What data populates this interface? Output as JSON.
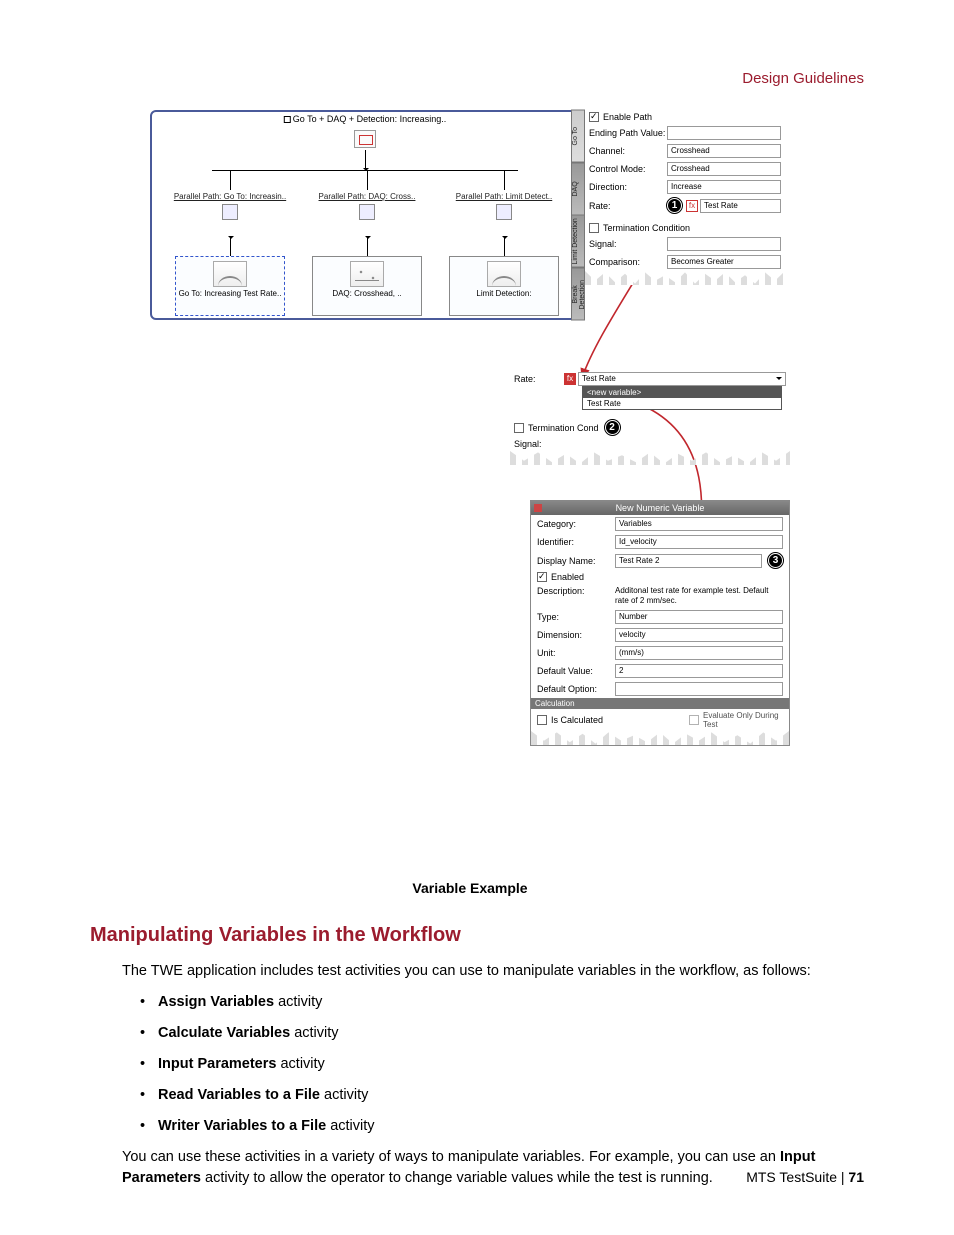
{
  "header": {
    "right": "Design Guidelines"
  },
  "workflow": {
    "title": "Go To + DAQ + Detection: Increasing..",
    "paths": [
      {
        "label": "Parallel Path: Go To: Increasin..",
        "block": "Go To: Increasing Test Rate.."
      },
      {
        "label": "Parallel Path: DAQ: Cross..",
        "block": "DAQ: Crosshead, .."
      },
      {
        "label": "Parallel Path: Limit Detect..",
        "block": "Limit Detection:"
      }
    ]
  },
  "props": {
    "tabs": [
      "Go To",
      "DAQ",
      "Limit Detection",
      "Break Detection"
    ],
    "enable_path_label": "Enable Path",
    "enable_path_checked": true,
    "rows": [
      {
        "label": "Ending Path Value:",
        "value": ""
      },
      {
        "label": "Channel:",
        "value": "Crosshead"
      },
      {
        "label": "Control Mode:",
        "value": "Crosshead"
      },
      {
        "label": "Direction:",
        "value": "Increase"
      }
    ],
    "rate_label": "Rate:",
    "rate_value": "Test Rate",
    "callout1": "1",
    "term_label": "Termination Condition",
    "term_checked": false,
    "signal_label": "Signal:",
    "signal_value": "",
    "comparison_label": "Comparison:",
    "comparison_value": "Becomes Greater"
  },
  "popout": {
    "rate_label": "Rate:",
    "rate_value": "Test Rate",
    "callout2": "2",
    "dd_opts": [
      "<new variable>",
      "Test Rate"
    ],
    "term_label": "Termination Cond",
    "signal_label": "Signal:"
  },
  "nv": {
    "title": "New Numeric Variable",
    "callout3": "3",
    "rows": {
      "category_label": "Category:",
      "category": "Variables",
      "identifier_label": "Identifier:",
      "identifier": "Id_velocity",
      "display_label": "Display Name:",
      "display": "Test Rate 2",
      "enabled_label": "Enabled",
      "enabled": true,
      "desc_label": "Description:",
      "desc": "Additonal test rate for example test. Default rate of 2 mm/sec.",
      "type_label": "Type:",
      "type": "Number",
      "dim_label": "Dimension:",
      "dim": "velocity",
      "unit_label": "Unit:",
      "unit": "(mm/s)",
      "defv_label": "Default Value:",
      "defv": "2",
      "defo_label": "Default Option:",
      "defo": ""
    },
    "calc_section": "Calculation",
    "iscalc_label": "Is Calculated",
    "evalonly_label": "Evaluate Only During Test"
  },
  "caption": "Variable Example",
  "section": {
    "heading": "Manipulating Variables in the Workflow",
    "intro": "The TWE application includes test activities you can use to manipulate variables in the workflow, as follows:",
    "items": [
      {
        "b": "Assign Variables",
        "rest": " activity"
      },
      {
        "b": "Calculate Variables",
        "rest": " activity"
      },
      {
        "b": "Input Parameters",
        "rest": " activity"
      },
      {
        "b": "Read Variables to a File",
        "rest": " activity"
      },
      {
        "b": "Writer Variables to a File",
        "rest": " activity"
      }
    ],
    "outro1": "You can use these activities in a variety of ways to manipulate variables. For example, you can use an ",
    "outro_b": "Input Parameters",
    "outro2": " activity to allow the operator to change variable values while the test is running."
  },
  "footer": {
    "left": "MTS TestSuite | ",
    "page": "71"
  }
}
